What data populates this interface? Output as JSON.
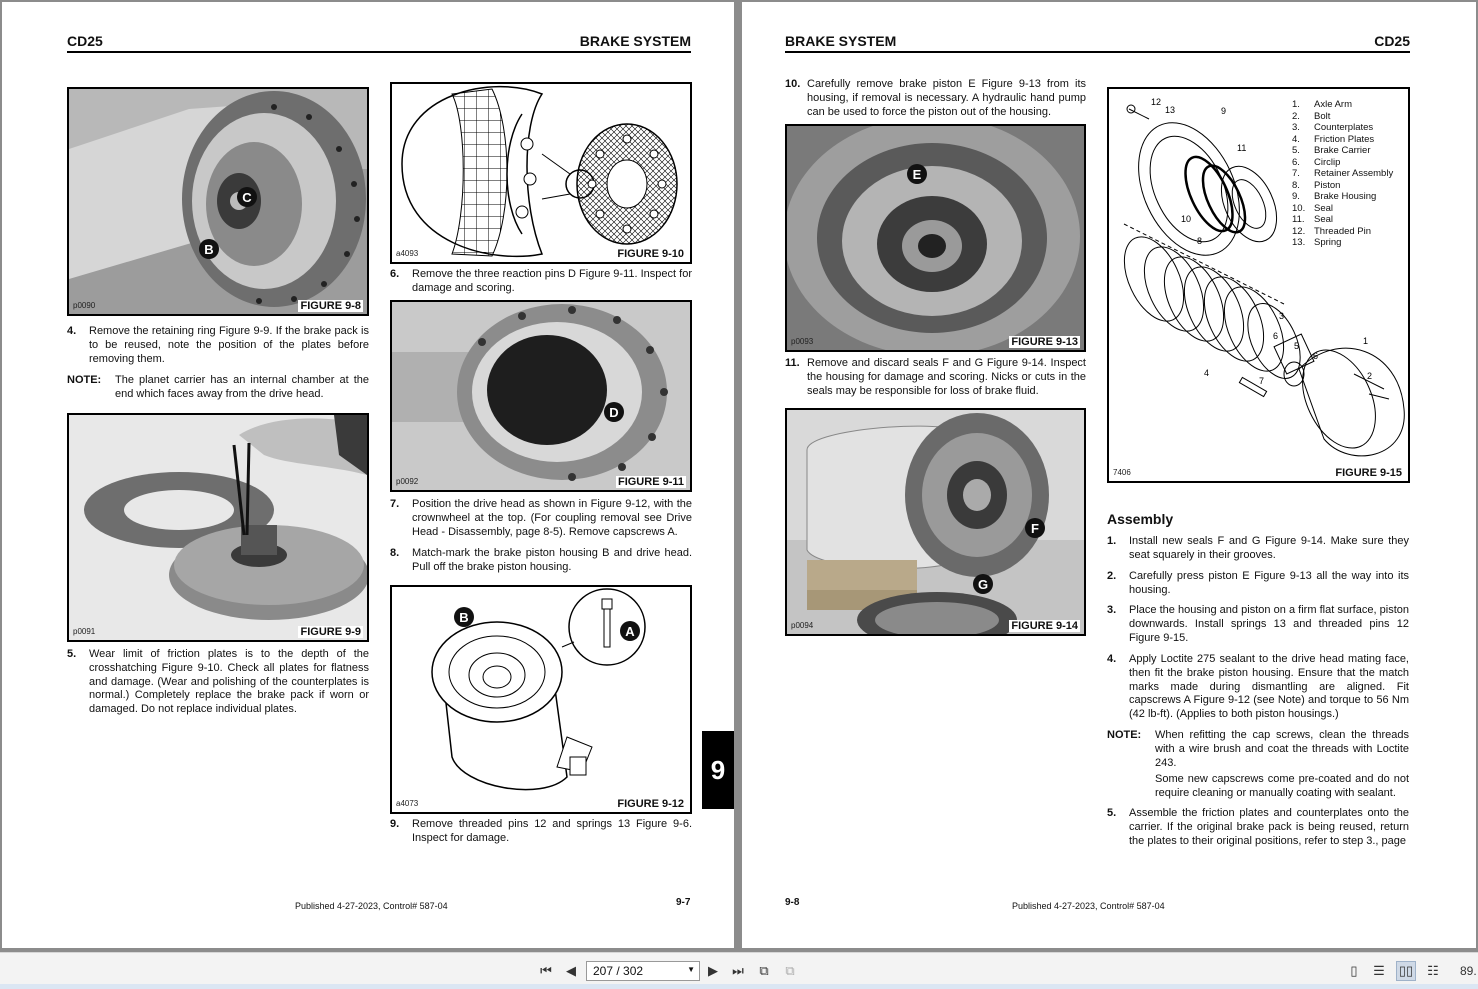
{
  "left_page": {
    "header_left": "CD25",
    "header_right": "BRAKE SYSTEM",
    "figures": [
      {
        "code": "p0090",
        "caption": "FIGURE 9-8",
        "labels": [
          "C",
          "B"
        ]
      },
      {
        "code": "a4093",
        "caption": "FIGURE 9-10"
      },
      {
        "code": "p0091",
        "caption": "FIGURE 9-9"
      },
      {
        "code": "p0092",
        "caption": "FIGURE 9-11",
        "labels": [
          "D"
        ]
      },
      {
        "code": "a4073",
        "caption": "FIGURE 9-12",
        "labels": [
          "B",
          "A"
        ]
      }
    ],
    "steps": {
      "s4_num": "4.",
      "s4": "Remove the retaining ring Figure 9-9. If the brake pack is to be reused, note the position of the plates before removing them.",
      "note_label": "NOTE:",
      "note": "The planet carrier has an internal chamber at the end which faces away from the drive head.",
      "s5_num": "5.",
      "s5": "Wear limit of friction plates is to the depth of the crosshatching Figure 9-10. Check all plates for flatness and damage. (Wear and polishing of the counterplates is normal.) Completely replace the brake pack if worn or damaged. Do not replace individual plates.",
      "s6_num": "6.",
      "s6": "Remove the three reaction pins D Figure 9-11. Inspect for damage and scoring.",
      "s7_num": "7.",
      "s7": "Position the drive head as shown in Figure 9-12, with the crownwheel at the top. (For coupling removal see Drive Head - Disassembly, page 8-5). Remove capscrews A.",
      "s8_num": "8.",
      "s8": "Match-mark the brake piston housing B and drive head. Pull off the brake piston housing.",
      "s9_num": "9.",
      "s9": "Remove threaded pins 12 and springs 13 Figure 9-6. Inspect for damage."
    },
    "footer": "Published 4-27-2023, Control# 587-04",
    "page_number": "9-7",
    "section_tab": "9"
  },
  "right_page": {
    "header_left": "BRAKE SYSTEM",
    "header_right": "CD25",
    "figures": [
      {
        "code": "p0093",
        "caption": "FIGURE 9-13",
        "labels": [
          "E"
        ]
      },
      {
        "code": "p0094",
        "caption": "FIGURE 9-14",
        "labels": [
          "F",
          "G"
        ]
      },
      {
        "code": "7406",
        "caption": "FIGURE 9-15"
      }
    ],
    "legend": [
      {
        "n": "1.",
        "label": "Axle Arm"
      },
      {
        "n": "2.",
        "label": "Bolt"
      },
      {
        "n": "3.",
        "label": "Counterplates"
      },
      {
        "n": "4.",
        "label": "Friction Plates"
      },
      {
        "n": "5.",
        "label": "Brake Carrier"
      },
      {
        "n": "6.",
        "label": "Circlip"
      },
      {
        "n": "7.",
        "label": "Retainer Assembly"
      },
      {
        "n": "8.",
        "label": "Piston"
      },
      {
        "n": "9.",
        "label": "Brake Housing"
      },
      {
        "n": "10.",
        "label": "Seal"
      },
      {
        "n": "11.",
        "label": "Seal"
      },
      {
        "n": "12.",
        "label": "Threaded Pin"
      },
      {
        "n": "13.",
        "label": "Spring"
      }
    ],
    "steps": {
      "s10_num": "10.",
      "s10": "Carefully remove brake piston E Figure 9-13 from its housing, if removal is necessary. A hydraulic hand pump can be used to force the piston out of the housing.",
      "s11_num": "11.",
      "s11": "Remove and discard seals F and G Figure 9-14. Inspect the housing for damage and scoring. Nicks or cuts in the seals may be responsible for loss of brake fluid."
    },
    "assembly_heading": "Assembly",
    "assembly": {
      "a1_num": "1.",
      "a1": "Install new seals F and G Figure 9-14. Make sure they seat squarely in their grooves.",
      "a2_num": "2.",
      "a2": "Carefully press piston E Figure 9-13 all the way into its housing.",
      "a3_num": "3.",
      "a3": "Place the housing and piston on a firm flat surface, piston downwards. Install springs 13 and threaded pins 12 Figure 9-15.",
      "a4_num": "4.",
      "a4": "Apply Loctite 275 sealant to the drive head mating face, then fit the brake piston housing. Ensure that the match marks made during dismantling are aligned. Fit capscrews A Figure 9-12 (see Note) and torque to 56 Nm (42 lb-ft). (Applies to both piston housings.)",
      "note_label": "NOTE:",
      "note1": "When refitting the cap screws, clean the threads with a wire brush and coat the threads with Loctite 243.",
      "note2": "Some new capscrews come pre-coated and do not require cleaning or manually coating with sealant.",
      "a5_num": "5.",
      "a5": "Assemble the friction plates and counterplates onto the carrier. If the original brake pack is being reused, return the plates to their original positions, refer to step 3., page"
    },
    "page_number": "9-8",
    "footer": "Published 4-27-2023, Control# 587-04"
  },
  "toolbar": {
    "page_field": "207 / 302",
    "zoom": "89.",
    "icons": [
      "first-page-icon",
      "prev-page-icon",
      "next-page-icon",
      "last-page-icon",
      "back-view-icon",
      "forward-view-icon",
      "single-page-icon",
      "continuous-icon",
      "two-page-icon",
      "two-page-continuous-icon"
    ]
  }
}
